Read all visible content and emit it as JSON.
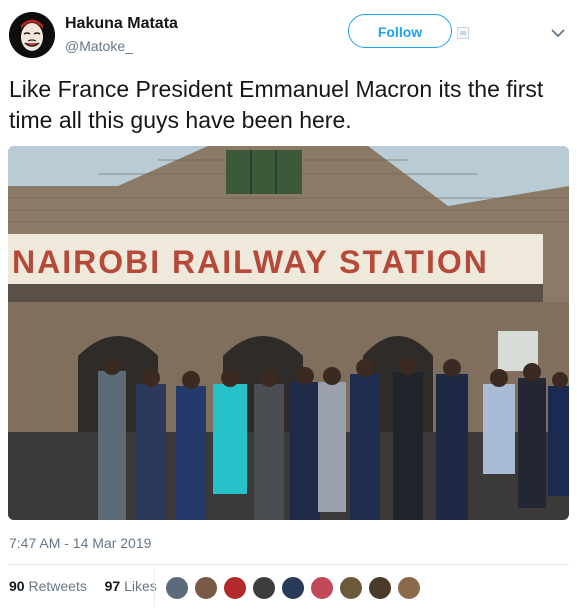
{
  "user": {
    "name": "Hakuna Matata",
    "handle": "@Matoke_"
  },
  "follow_label": "Follow",
  "tweet": {
    "text": "Like France President Emmanuel Macron its the first time all this guys have been here.",
    "timestamp": "7:47 AM - 14 Mar 2019"
  },
  "photo": {
    "sign_text": "NAIROBI RAILWAY STATION"
  },
  "stats": {
    "retweets_count": "90",
    "retweets_label": "Retweets",
    "likes_count": "97",
    "likes_label": "Likes"
  },
  "colors": {
    "accent": "#1da1f2",
    "muted": "#657786",
    "text": "#14171a"
  },
  "icons": [
    "mute-icon",
    "chevron-down-icon"
  ]
}
